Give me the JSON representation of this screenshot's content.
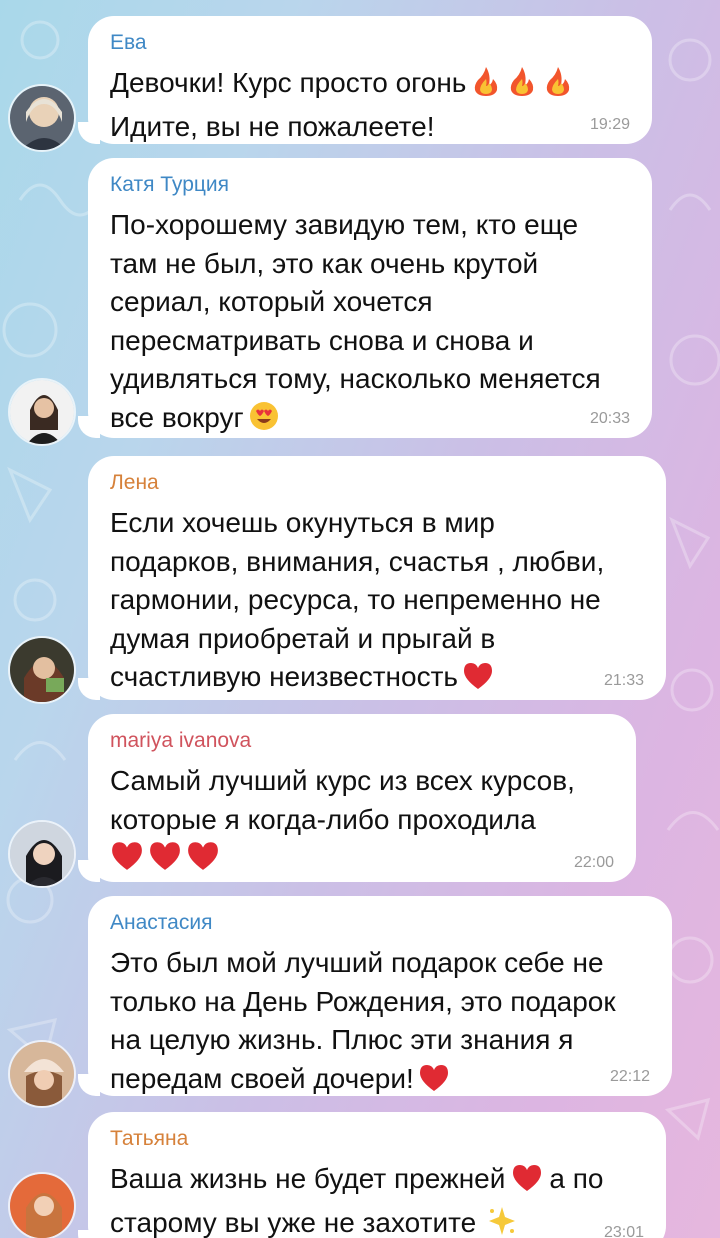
{
  "colors": {
    "sender_blue": "#3f88c5",
    "sender_orange": "#d6813a",
    "sender_pink": "#d0535d",
    "bubble": "#ffffff",
    "time": "#9a9a9a"
  },
  "messages": [
    {
      "sender": "Ева",
      "sender_color": "#3f88c5",
      "line1": "Девочки! Курс просто огонь",
      "line2": "Идите, вы не пожалеете!",
      "emoji": "fire-icon x3",
      "time": "19:29"
    },
    {
      "sender": "Катя Турция",
      "sender_color": "#3f88c5",
      "text": "По-хорошему завидую тем, кто еще\nтам не был, это как очень крутой\nсериал, который хочется\nпересматривать снова и снова и\nудивляться тому, насколько меняется\nвсе вокруг",
      "emoji": "heart-eyes-icon",
      "time": "20:33"
    },
    {
      "sender": "Лена",
      "sender_color": "#d6813a",
      "text": "Если хочешь окунуться в мир\nподарков, внимания, счастья , любви,\nгармонии, ресурса, то непременно не\nдумая приобретай и прыгай в\nсчастливую неизвестность",
      "emoji": "heart-icon",
      "time": "21:33"
    },
    {
      "sender": "mariya ivanova",
      "sender_color": "#d0535d",
      "text": "Самый лучший курс из всех курсов,\nкоторые я когда-либо проходила",
      "emoji": "heart-icon x3",
      "time": "22:00"
    },
    {
      "sender": "Анастасия",
      "sender_color": "#3f88c5",
      "text": "Это был мой лучший подарок себе не\nтолько на День Рождения, это подарок\nна целую жизнь. Плюс эти знания я\nпередам своей дочери!",
      "emoji": "heart-icon",
      "time": "22:12"
    },
    {
      "sender": "Татьяна",
      "sender_color": "#d6813a",
      "line1a": "Ваша жизнь не будет прежней",
      "line1b": "а по",
      "line2": "старому вы уже не захотите",
      "emoji": "heart-icon, sparkle-icon",
      "time": "23:01"
    }
  ]
}
